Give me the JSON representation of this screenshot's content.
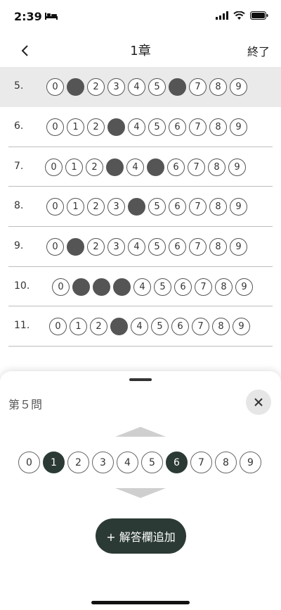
{
  "status": {
    "time": "2:39"
  },
  "nav": {
    "title": "1章",
    "finish": "終了"
  },
  "rows": [
    {
      "label": "5.",
      "offset": 54,
      "selected": true,
      "filled": [
        1,
        6
      ]
    },
    {
      "label": "6.",
      "offset": 54,
      "selected": false,
      "filled": [
        3
      ]
    },
    {
      "label": "7.",
      "offset": 52,
      "selected": false,
      "filled": [
        3,
        5
      ]
    },
    {
      "label": "8.",
      "offset": 54,
      "selected": false,
      "filled": [
        4
      ]
    },
    {
      "label": "9.",
      "offset": 54,
      "selected": false,
      "filled": [
        1
      ]
    },
    {
      "label": "10.",
      "offset": 62,
      "selected": false,
      "filled": [
        1,
        2,
        3
      ]
    },
    {
      "label": "11.",
      "offset": 58,
      "selected": false,
      "filled": [
        3
      ]
    }
  ],
  "digits": [
    "0",
    "1",
    "2",
    "3",
    "4",
    "5",
    "6",
    "7",
    "8",
    "9"
  ],
  "sheet": {
    "title": "第５問",
    "selected": [
      1,
      6
    ],
    "add_label": "+ 解答欄追加"
  }
}
